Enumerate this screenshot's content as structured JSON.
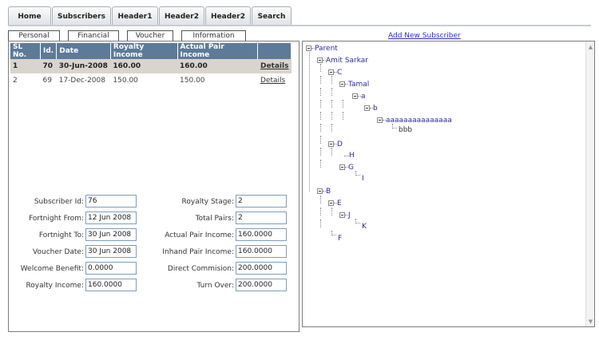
{
  "nav": {
    "tabs": [
      "Home",
      "Subscribers",
      "Header1",
      "Header2",
      "Header2",
      "Search"
    ]
  },
  "subtabs": [
    "Personal",
    "Financial",
    "Voucher",
    "Information"
  ],
  "add_subscriber_link": "Add New Subscriber",
  "table": {
    "columns": [
      "SL No.",
      "Id.",
      "Date",
      "Royalty Income",
      "Actual Pair Income",
      ""
    ],
    "rows": [
      {
        "sl": "1",
        "id": "70",
        "date": "30-Jun-2008",
        "royalty": "160.00",
        "actual": "160.00",
        "action": "Details"
      },
      {
        "sl": "2",
        "id": "69",
        "date": "17-Dec-2008",
        "royalty": "150.00",
        "actual": "150.00",
        "action": "Details"
      }
    ]
  },
  "form": {
    "subscriber_id": {
      "label": "Subscriber Id:",
      "value": "76"
    },
    "fortnight_from": {
      "label": "Fortnight From:",
      "value": "12 Jun 2008"
    },
    "fortnight_to": {
      "label": "Fortnight To:",
      "value": "30 Jun 2008"
    },
    "voucher_date": {
      "label": "Voucher Date:",
      "value": "30 Jun 2008"
    },
    "welcome_benefit": {
      "label": "Welcome Benefit:",
      "value": "0.0000"
    },
    "royalty_income": {
      "label": "Royalty Income:",
      "value": "160.0000"
    },
    "royalty_stage": {
      "label": "Royalty Stage:",
      "value": "2"
    },
    "total_pairs": {
      "label": "Total Pairs:",
      "value": "2"
    },
    "actual_pair_income": {
      "label": "Actual Pair Income:",
      "value": "160.0000"
    },
    "inhand_pair_income": {
      "label": "Inhand Pair Income:",
      "value": "160.0000"
    },
    "direct_commision": {
      "label": "Direct Commision:",
      "value": "200.0000"
    },
    "turn_over": {
      "label": "Turn Over:",
      "value": "200.0000"
    }
  },
  "tree": {
    "nodes": [
      "Parent",
      "Amit Sarkar",
      "C",
      "Tamal",
      "a",
      "b",
      "aaaaaaaaaaaaaaa",
      "bbb",
      "D",
      "H",
      "G",
      "I",
      "B",
      "E",
      "J",
      "K",
      "F"
    ]
  }
}
